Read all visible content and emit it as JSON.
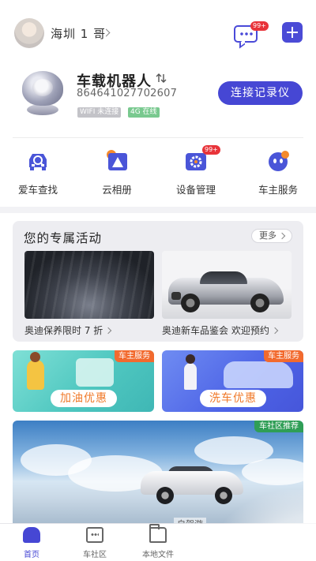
{
  "header": {
    "user_name": "海圳 1 哥",
    "message_badge": "99+"
  },
  "device": {
    "name": "车载机器人",
    "id": "864641027702607",
    "wifi_status": "WIFI 未连接",
    "network_status": "4G 在线",
    "connect_button": "连接记录仪"
  },
  "shortcuts": [
    {
      "label": "爱车查找",
      "icon": "car-search-icon"
    },
    {
      "label": "云相册",
      "icon": "cloud-album-icon"
    },
    {
      "label": "设备管理",
      "icon": "device-settings-icon",
      "badge": "99+"
    },
    {
      "label": "车主服务",
      "icon": "owner-service-icon"
    }
  ],
  "activities": {
    "title": "您的专属活动",
    "more": "更多",
    "items": [
      {
        "caption": "奥迪保养限时 7 折"
      },
      {
        "caption": "奥迪新车品鉴会 欢迎预约"
      }
    ]
  },
  "services": [
    {
      "tag": "车主服务",
      "button": "加油优惠"
    },
    {
      "tag": "车主服务",
      "button": "洗车优惠"
    }
  ],
  "banner": {
    "tag": "车社区推荐",
    "caption": "自驾游"
  },
  "tabbar": [
    {
      "label": "首页",
      "active": true
    },
    {
      "label": "车社区"
    },
    {
      "label": "本地文件"
    }
  ],
  "colors": {
    "accent": "#4647d4",
    "badge": "#e8343a",
    "service_tag": "#f26a2e",
    "community_tag": "#2f9e56"
  }
}
